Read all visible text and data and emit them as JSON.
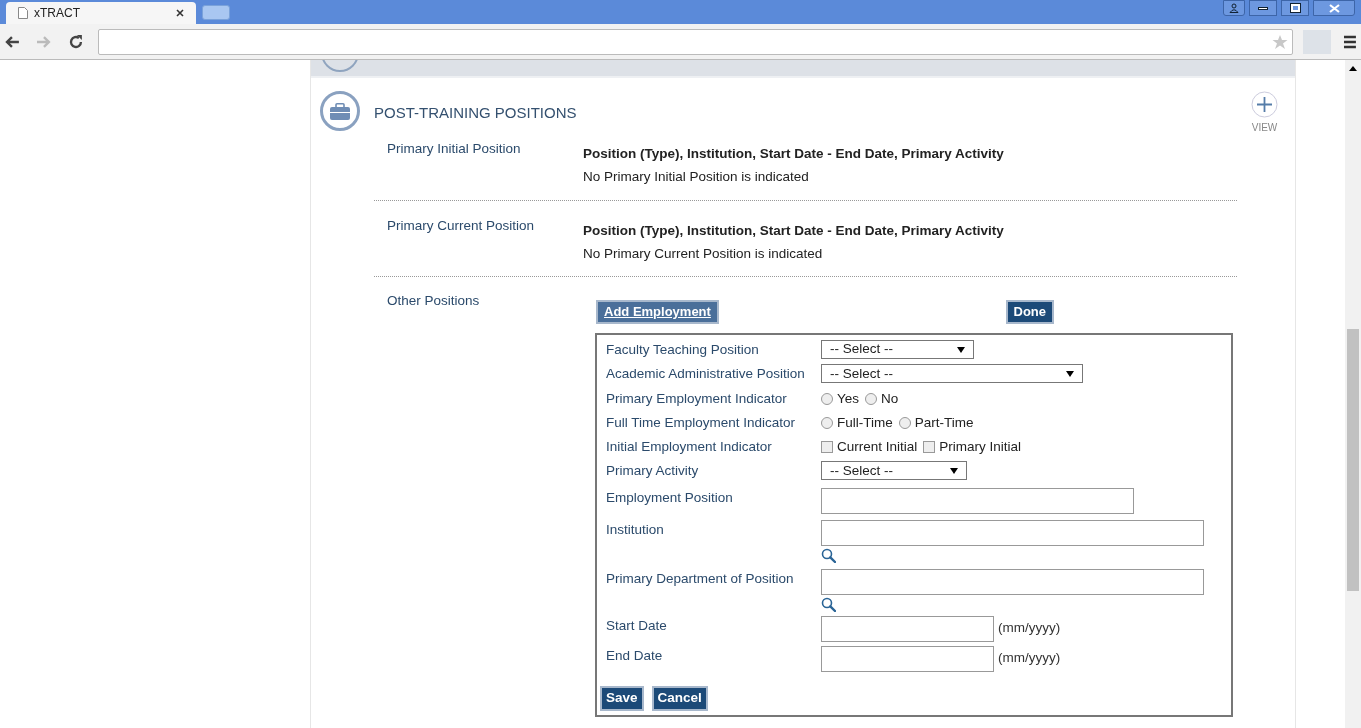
{
  "browser": {
    "tab_title": "xTRACT"
  },
  "section": {
    "title": "POST-TRAINING POSITIONS",
    "view_label": "VIEW"
  },
  "position_rows": [
    {
      "label": "Primary Initial Position",
      "heading": "Position (Type), Institution, Start Date - End Date, Primary Activity",
      "value": "No Primary Initial Position is indicated"
    },
    {
      "label": "Primary Current Position",
      "heading": "Position (Type), Institution, Start Date - End Date, Primary Activity",
      "value": "No Primary Current Position is indicated"
    }
  ],
  "other_positions": {
    "label": "Other Positions",
    "add_button": "Add Employment",
    "done_button": "Done"
  },
  "form": {
    "fields": [
      {
        "kind": "select",
        "label": "Faculty Teaching Position",
        "value": "-- Select --"
      },
      {
        "kind": "select",
        "label": "Academic Administrative Position",
        "value": "-- Select --"
      },
      {
        "kind": "radio",
        "label": "Primary Employment Indicator",
        "options": [
          {
            "label": "Yes",
            "selected": false
          },
          {
            "label": "No",
            "selected": false
          }
        ]
      },
      {
        "kind": "radio",
        "label": "Full Time Employment Indicator",
        "options": [
          {
            "label": "Full-Time",
            "selected": false
          },
          {
            "label": "Part-Time",
            "selected": false
          }
        ]
      },
      {
        "kind": "checkbox",
        "label": "Initial Employment Indicator",
        "options": [
          {
            "label": "Current Initial",
            "checked": false
          },
          {
            "label": "Primary Initial",
            "checked": false
          }
        ]
      },
      {
        "kind": "select",
        "label": "Primary Activity",
        "value": "-- Select --"
      },
      {
        "kind": "text",
        "label": "Employment Position"
      },
      {
        "kind": "lookup",
        "label": "Institution"
      },
      {
        "kind": "lookup",
        "label": "Primary Department of Position"
      },
      {
        "kind": "date",
        "label": "Start Date",
        "hint": "(mm/yyyy)"
      },
      {
        "kind": "date",
        "label": "End Date",
        "hint": "(mm/yyyy)"
      }
    ],
    "buttons": [
      "Save",
      "Cancel"
    ]
  }
}
